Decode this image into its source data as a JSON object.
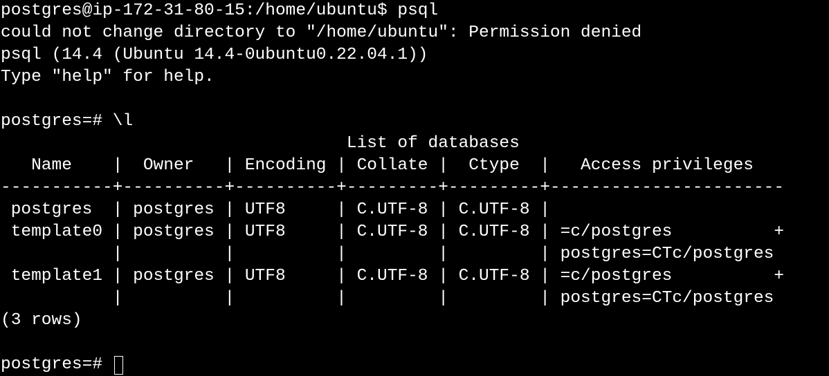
{
  "terminal": {
    "lines": [
      "postgres@ip-172-31-80-15:/home/ubuntu$ psql",
      "could not change directory to \"/home/ubuntu\": Permission denied",
      "psql (14.4 (Ubuntu 14.4-0ubuntu0.22.04.1))",
      "Type \"help\" for help.",
      "",
      "postgres=# \\l",
      "                                  List of databases",
      "   Name    |  Owner   | Encoding | Collate |  Ctype  |   Access privileges",
      "-----------+----------+----------+---------+---------+-----------------------",
      " postgres  | postgres | UTF8     | C.UTF-8 | C.UTF-8 |",
      " template0 | postgres | UTF8     | C.UTF-8 | C.UTF-8 | =c/postgres          +",
      "           |          |          |         |         | postgres=CTc/postgres",
      " template1 | postgres | UTF8     | C.UTF-8 | C.UTF-8 | =c/postgres          +",
      "           |          |          |         |         | postgres=CTc/postgres",
      "(3 rows)",
      ""
    ],
    "prompt": "postgres=# "
  },
  "colors": {
    "background": "#000000",
    "foreground": "#ffffff"
  }
}
